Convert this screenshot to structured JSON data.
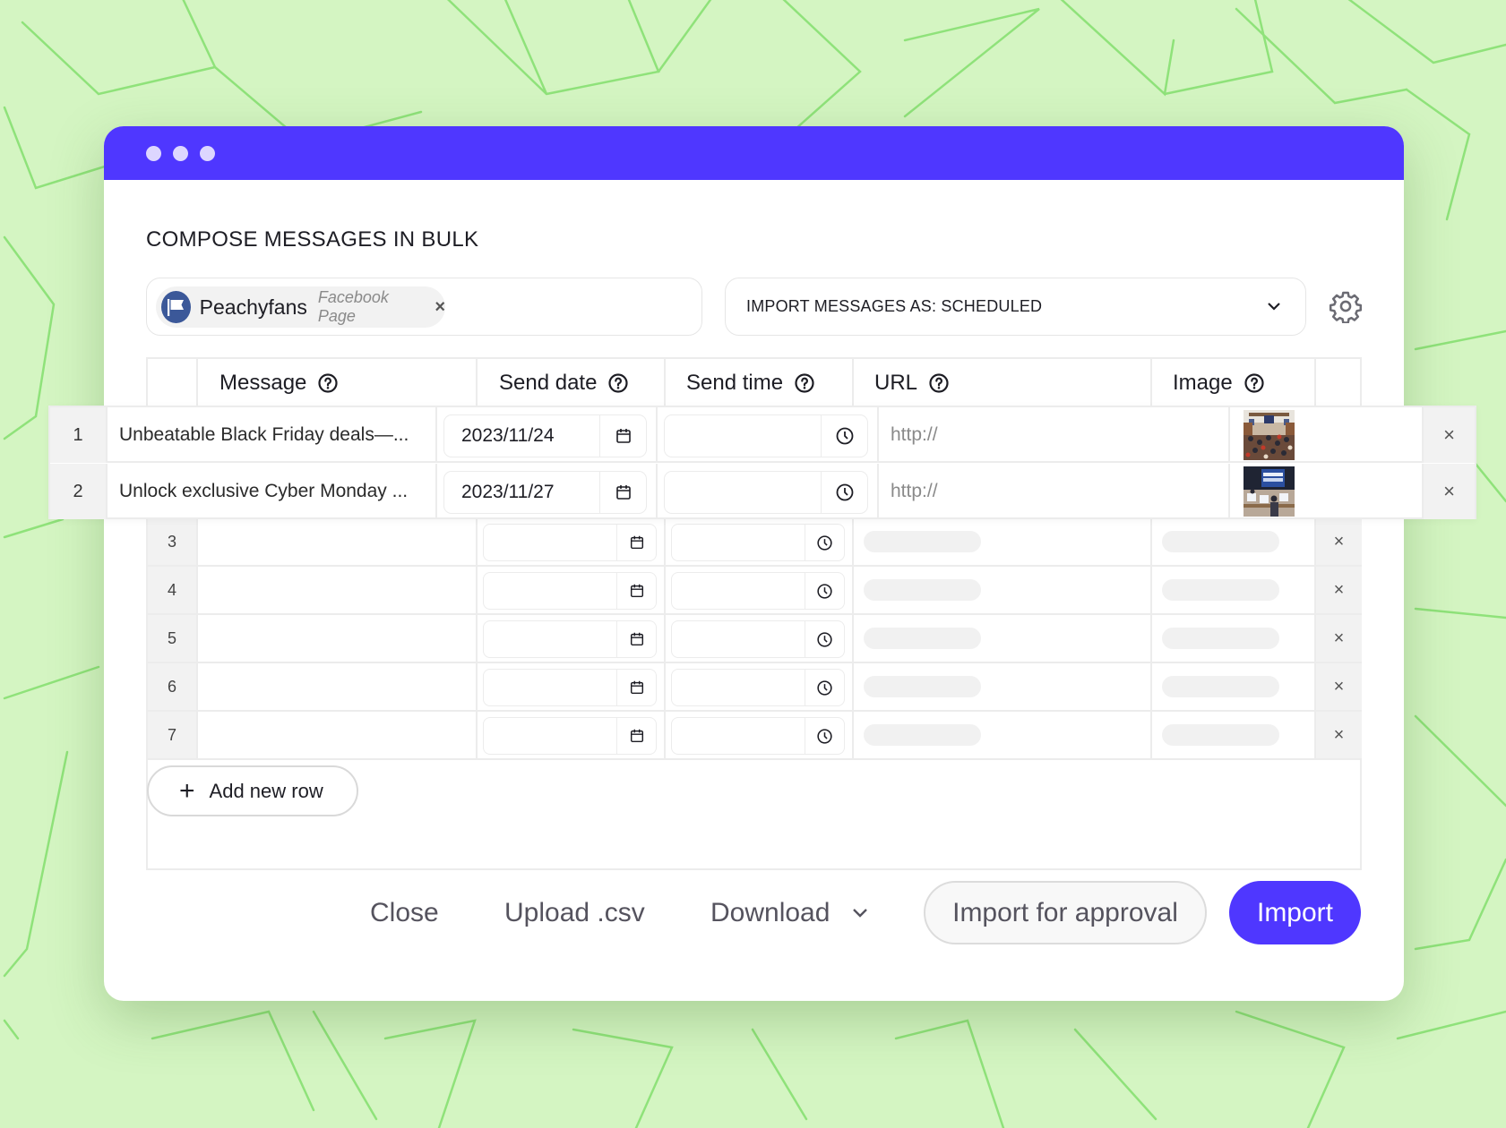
{
  "window": {
    "title": "COMPOSE MESSAGES IN BULK",
    "accent_color": "#4f37ff"
  },
  "account": {
    "name": "Peachyfans",
    "type": "Facebook Page",
    "icon": "flag-icon",
    "remove_label": "×"
  },
  "import_mode": {
    "label": "IMPORT MESSAGES AS: SCHEDULED",
    "icon": "chevron-down-icon"
  },
  "settings": {
    "icon": "gear-icon"
  },
  "table": {
    "columns": [
      "Message",
      "Send date",
      "Send time",
      "URL",
      "Image"
    ],
    "rows": [
      {
        "num": "1",
        "message": "Unbeatable Black Friday deals—...",
        "send_date": "2023/11/24",
        "send_time": "",
        "url_placeholder": "http://",
        "image": "black-friday-crowd-thumbnail"
      },
      {
        "num": "2",
        "message": "Unlock exclusive Cyber Monday ...",
        "send_date": "2023/11/27",
        "send_time": "",
        "url_placeholder": "http://",
        "image": "cyber-monday-thumbnail"
      },
      {
        "num": "3",
        "message": "",
        "send_date": "",
        "send_time": ""
      },
      {
        "num": "4",
        "message": "",
        "send_date": "",
        "send_time": ""
      },
      {
        "num": "5",
        "message": "",
        "send_date": "",
        "send_time": ""
      },
      {
        "num": "6",
        "message": "",
        "send_date": "",
        "send_time": ""
      },
      {
        "num": "7",
        "message": "",
        "send_date": "",
        "send_time": ""
      }
    ],
    "delete_label": "×"
  },
  "add_row": {
    "label": "Add new row",
    "icon": "plus-icon"
  },
  "footer": {
    "close": "Close",
    "upload": "Upload .csv",
    "download": "Download",
    "import_for_approval": "Import for approval",
    "import": "Import"
  }
}
